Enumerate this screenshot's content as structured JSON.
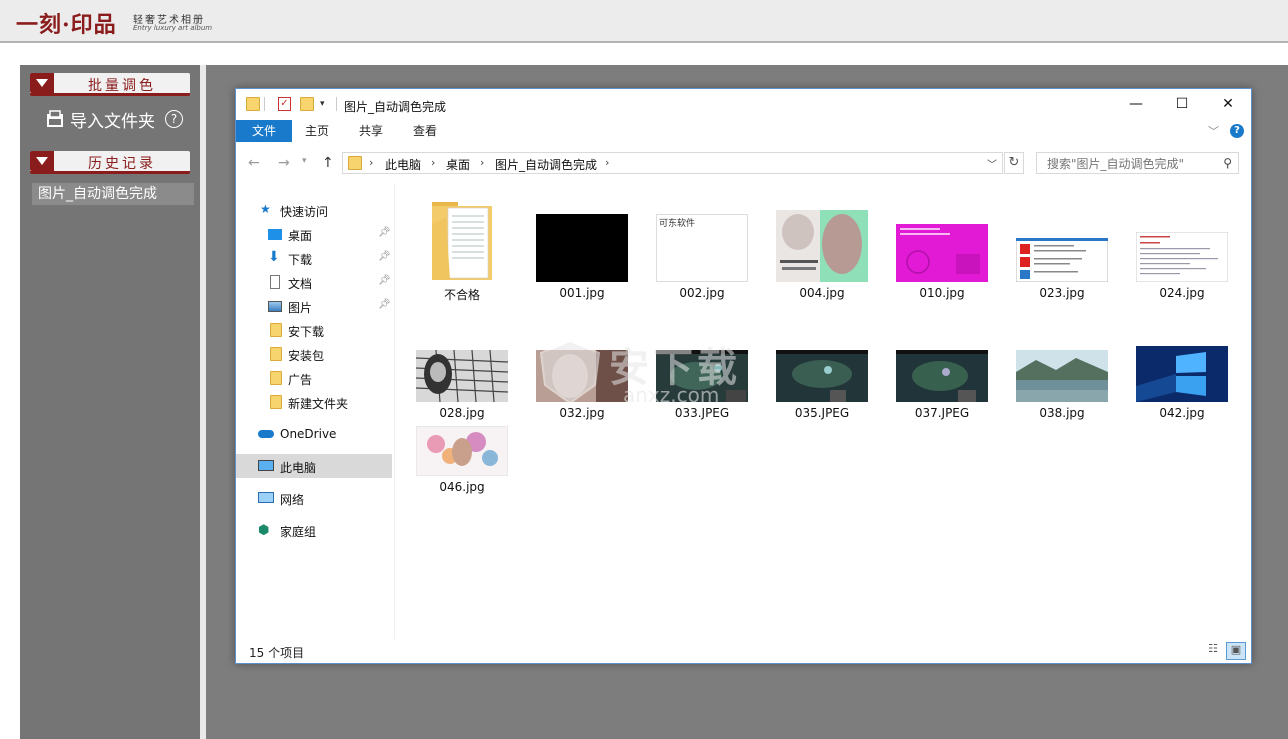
{
  "app": {
    "logo_main": "一刻·印品",
    "logo_sub_cn": "轻奢艺术相册",
    "logo_sub_en": "Entry luxury art album"
  },
  "sidebar": {
    "batch_section": "批量调色",
    "import_label": "导入文件夹",
    "help_symbol": "?",
    "history_section": "历史记录",
    "history_items": [
      "图片_自动调色完成"
    ]
  },
  "explorer": {
    "title": "图片_自动调色完成",
    "window_buttons": {
      "minimize": "—",
      "maximize": "☐",
      "close": "✕"
    },
    "ribbon_tabs": [
      "文件",
      "主页",
      "共享",
      "查看"
    ],
    "ribbon_help": "?",
    "breadcrumb": [
      "此电脑",
      "桌面",
      "图片_自动调色完成"
    ],
    "search_placeholder": "搜索\"图片_自动调色完成\"",
    "nav": {
      "quick_access": "快速访问",
      "pinned": [
        {
          "label": "桌面",
          "icon": "desktop-icon"
        },
        {
          "label": "下载",
          "icon": "download-icon"
        },
        {
          "label": "文档",
          "icon": "document-icon"
        },
        {
          "label": "图片",
          "icon": "pictures-icon"
        }
      ],
      "folders": [
        "安下载",
        "安装包",
        "广告",
        "新建文件夹"
      ],
      "onedrive": "OneDrive",
      "this_pc": "此电脑",
      "network": "网络",
      "homegroup": "家庭组"
    },
    "files": [
      {
        "name": "不合格",
        "kind": "folder"
      },
      {
        "name": "001.jpg",
        "kind": "black"
      },
      {
        "name": "002.jpg",
        "kind": "white-text",
        "caption": "可东软件"
      },
      {
        "name": "004.jpg",
        "kind": "portrait"
      },
      {
        "name": "010.jpg",
        "kind": "magenta"
      },
      {
        "name": "023.jpg",
        "kind": "dialog"
      },
      {
        "name": "024.jpg",
        "kind": "document"
      },
      {
        "name": "028.jpg",
        "kind": "bw-grid"
      },
      {
        "name": "032.jpg",
        "kind": "portrait-dark"
      },
      {
        "name": "033.JPEG",
        "kind": "game"
      },
      {
        "name": "035.JPEG",
        "kind": "game"
      },
      {
        "name": "037.JPEG",
        "kind": "game"
      },
      {
        "name": "038.jpg",
        "kind": "landscape"
      },
      {
        "name": "042.jpg",
        "kind": "windows"
      },
      {
        "name": "046.jpg",
        "kind": "floral"
      }
    ],
    "status": "15 个项目"
  },
  "watermark": {
    "text": "安下载",
    "sub": "anxz.com"
  },
  "colors": {
    "brand": "#8a1c1c",
    "accent": "#1979ca"
  }
}
